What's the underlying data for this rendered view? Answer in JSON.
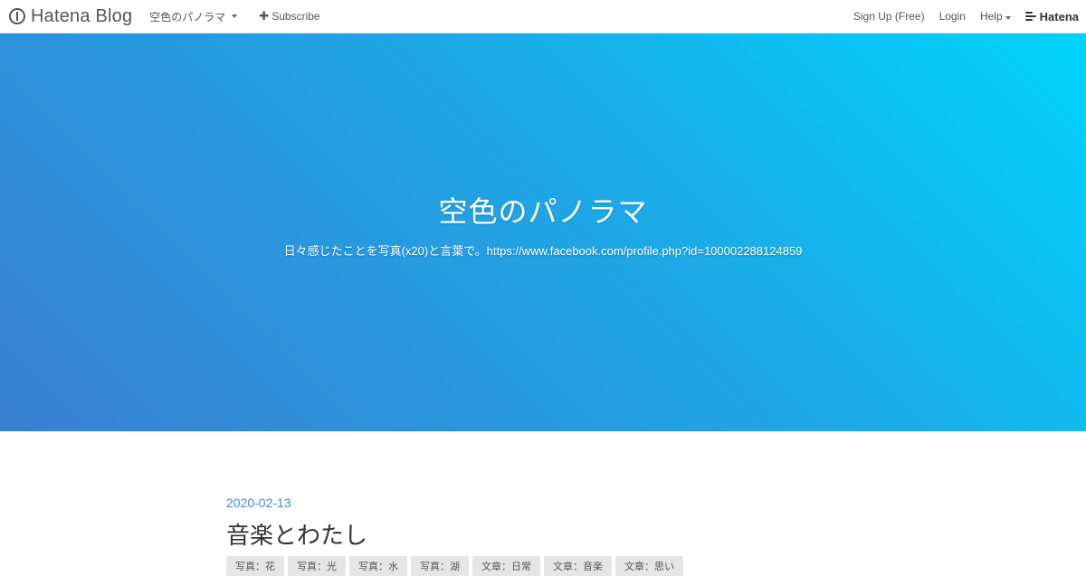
{
  "topbar": {
    "brand": "Hatena Blog",
    "blog_menu": "空色のパノラマ",
    "subscribe": "Subscribe",
    "signup": "Sign Up (Free)",
    "login": "Login",
    "help": "Help",
    "hatena": "Hatena"
  },
  "hero": {
    "title": "空色のパノラマ",
    "description": "日々感じたことを写真(x20)と言葉で。https://www.facebook.com/profile.php?id=100002288124859"
  },
  "entry": {
    "date": "2020-02-13",
    "title": "音楽とわたし",
    "tags": [
      "写真：花",
      "写真：光",
      "写真：水",
      "写真：湖",
      "文章：日常",
      "文章：音楽",
      "文章：思い"
    ]
  },
  "colors": {
    "gradient_start": "#3a7fd1",
    "gradient_end": "#00d3fc",
    "date": "#3b8fd6"
  }
}
